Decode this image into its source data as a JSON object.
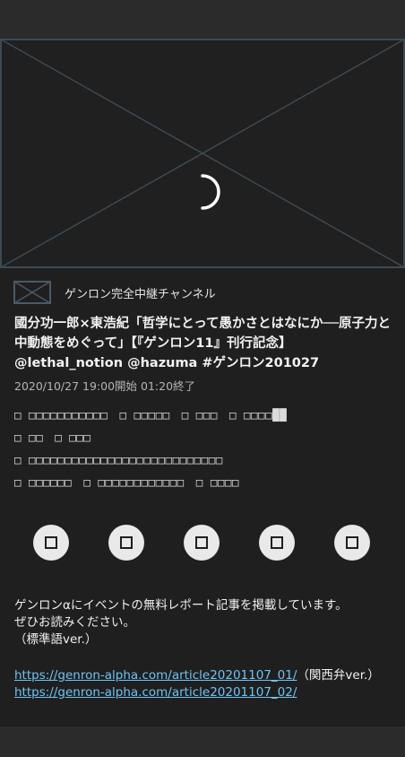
{
  "channel": {
    "name": "ゲンロン完全中継チャンネル",
    "icon": "mail-icon"
  },
  "program": {
    "title": "國分功一郎×東浩紀「哲学にとって愚かさとはなにか──原子力と中動態をめぐって」【『ゲンロン11』刊行記念】 @lethal_notion @hazuma #ゲンロン201027",
    "datetime": "2020/10/27 19:00開始 01:20終了"
  },
  "tags": [
    [
      "□ □□□□□□□□□□□",
      "□ □□□□□",
      "□ □□□",
      "□ □□□□██"
    ],
    [
      "□ □□",
      "□ □□□"
    ],
    [
      "□ □□□□□□□□□□□□□□□□□□□□□□□□□□□"
    ],
    [
      "□ □□□□□□",
      "□ □□□□□□□□□□□□",
      "□ □□□□"
    ]
  ],
  "share_buttons": [
    "share-button-1",
    "share-button-2",
    "share-button-3",
    "share-button-4",
    "share-button-5"
  ],
  "description": {
    "line1": "ゲンロンαにイベントの無料レポート記事を掲載しています。",
    "line2": "ぜひお読みください。",
    "line3": "（標準語ver.）",
    "link1": "https://genron-alpha.com/article20201107_01/",
    "link1_note": "（関西弁ver.）",
    "link2": "https://genron-alpha.com/article20201107_02/"
  },
  "colors": {
    "background": "#1f1f1f",
    "bars": "#2b2b2b",
    "placeholder_lines": "#3c4a55",
    "link": "#6fc3f5"
  }
}
